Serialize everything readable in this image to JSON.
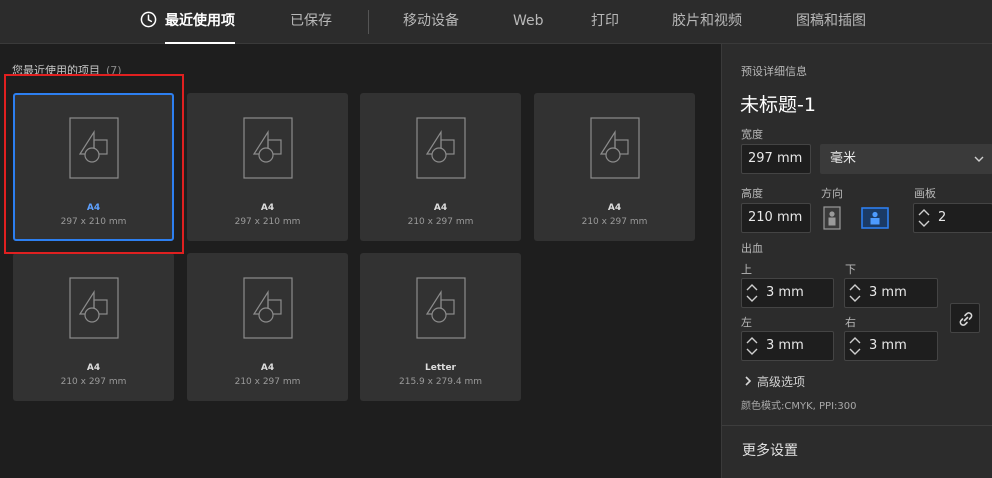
{
  "tabs": [
    {
      "label": "最近使用项",
      "active": true
    },
    {
      "label": "已保存"
    },
    {
      "label": "移动设备"
    },
    {
      "label": "Web"
    },
    {
      "label": "打印"
    },
    {
      "label": "胶片和视频"
    },
    {
      "label": "图稿和插图"
    }
  ],
  "recent": {
    "title": "您最近使用的项目",
    "count": "(7)",
    "items": [
      {
        "name": "A4",
        "size": "297 x 210 mm",
        "selected": true
      },
      {
        "name": "A4",
        "size": "297 x 210 mm"
      },
      {
        "name": "A4",
        "size": "210 x 297 mm"
      },
      {
        "name": "A4",
        "size": "210 x 297 mm"
      },
      {
        "name": "A4",
        "size": "210 x 297 mm"
      },
      {
        "name": "A4",
        "size": "210 x 297 mm"
      },
      {
        "name": "Letter",
        "size": "215.9 x 279.4 mm"
      }
    ]
  },
  "details": {
    "section_label": "预设详细信息",
    "doc_title": "未标题-1",
    "width_label": "宽度",
    "width_value": "297 mm",
    "unit_value": "毫米",
    "height_label": "高度",
    "height_value": "210 mm",
    "orientation_label": "方向",
    "artboards_label": "画板",
    "artboards_value": "2",
    "bleed_label": "出血",
    "bleed_top_label": "上",
    "bleed_top_value": "3 mm",
    "bleed_bottom_label": "下",
    "bleed_bottom_value": "3 mm",
    "bleed_left_label": "左",
    "bleed_left_value": "3 mm",
    "bleed_right_label": "右",
    "bleed_right_value": "3 mm",
    "advanced_label": "高级选项",
    "color_mode": "颜色模式:CMYK, PPI:300",
    "more_settings": "更多设置"
  },
  "colors": {
    "accent": "#2d7ff0",
    "highlight": "#e02020"
  },
  "icons": {
    "recent_tab": "clock-icon",
    "document": "document-shapes-icon",
    "portrait": "portrait-orientation-icon",
    "landscape": "landscape-orientation-icon",
    "link": "link-icon",
    "dropdown": "chevron-down-icon",
    "advanced": "chevron-right-icon"
  }
}
